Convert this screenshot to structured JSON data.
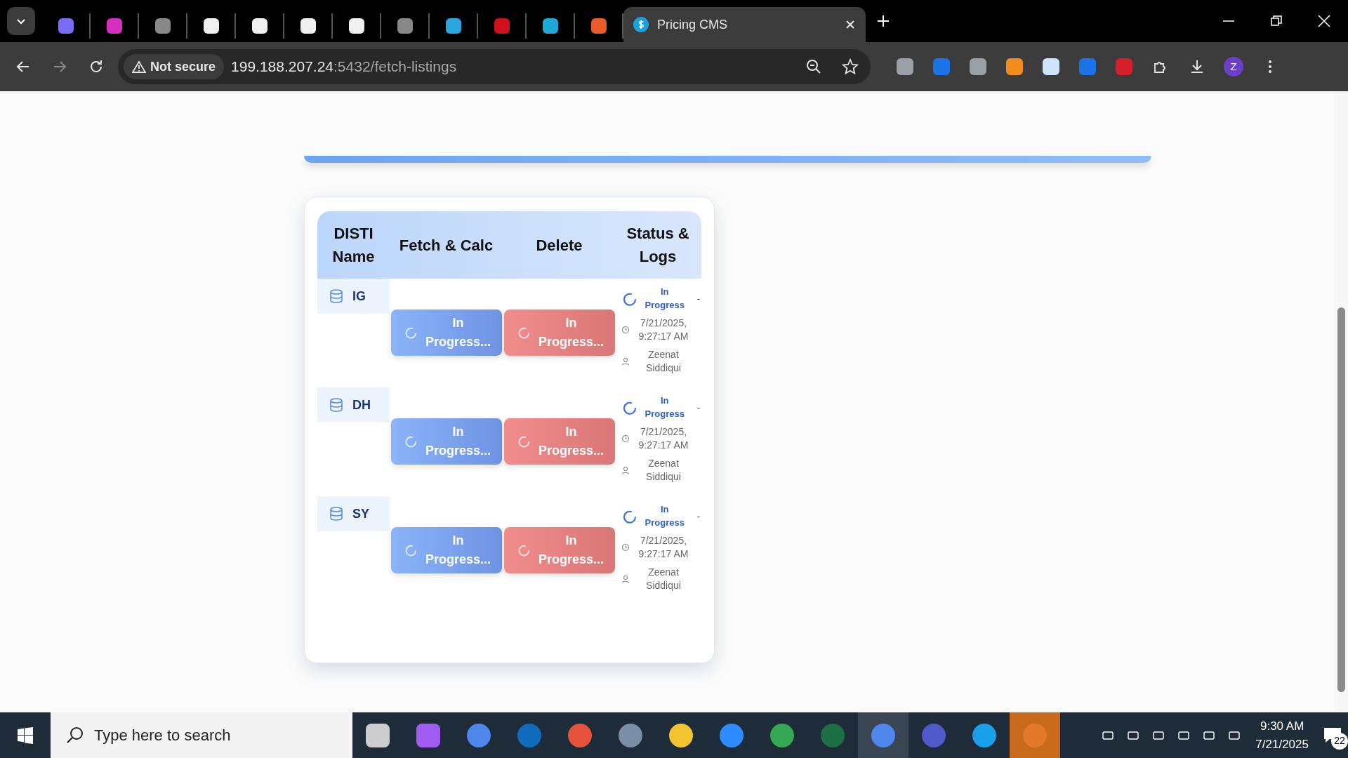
{
  "browser": {
    "tabs": [
      {
        "selected": false
      },
      {
        "selected": false
      },
      {
        "selected": false
      },
      {
        "selected": false
      },
      {
        "selected": false
      },
      {
        "selected": false
      },
      {
        "selected": false
      },
      {
        "selected": false
      },
      {
        "selected": false
      },
      {
        "selected": false
      },
      {
        "selected": false
      },
      {
        "selected": false
      },
      {
        "title": "Pricing CMS",
        "selected": true
      }
    ],
    "address": {
      "security": "Not secure",
      "host": "199.188.207.24",
      "path": ":5432/fetch-listings"
    },
    "profile": "Z"
  },
  "table": {
    "columns": [
      "DISTI Name",
      "Fetch & Calc",
      "Delete",
      "Status & Logs"
    ],
    "rows": [
      {
        "name": "IG",
        "fetch": {
          "label": "In Progress...",
          "busy": true
        },
        "delete": {
          "label": "In Progress...",
          "busy": true
        },
        "status": {
          "label": "In Progress",
          "extra": "-",
          "time": "7/21/2025, 9:27:17 AM",
          "user": "Zeenat Siddiqui"
        }
      },
      {
        "name": "DH",
        "fetch": {
          "label": "In Progress...",
          "busy": true
        },
        "delete": {
          "label": "In Progress...",
          "busy": true
        },
        "status": {
          "label": "In Progress",
          "extra": "-",
          "time": "7/21/2025, 9:27:17 AM",
          "user": "Zeenat Siddiqui"
        }
      },
      {
        "name": "SY",
        "fetch": {
          "label": "In Progress...",
          "busy": true
        },
        "delete": {
          "label": "In Progress...",
          "busy": true
        },
        "status": {
          "label": "In Progress",
          "extra": "-",
          "time": "7/21/2025, 9:27:17 AM",
          "user": "Zeenat Siddiqui"
        }
      }
    ]
  },
  "taskbar": {
    "search": {
      "placeholder": "Type here to search"
    },
    "time": "9:30 AM",
    "date": "7/21/2025",
    "notifications": "22"
  }
}
